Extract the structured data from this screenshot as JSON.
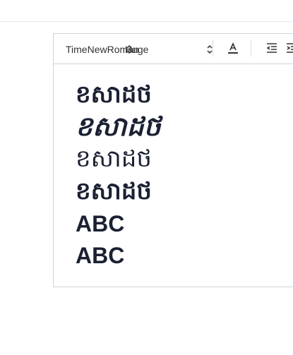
{
  "toolbar": {
    "font_family": "TimeNewRoman",
    "font_size": "Huge"
  },
  "content": {
    "lines": [
      "ខសាដថ",
      "ខសាដថ",
      "ខសាដថ",
      "ខសាដថ",
      "ABC",
      "ABC"
    ]
  },
  "icons": {
    "font_color": "text-color-icon",
    "outdent": "outdent-icon",
    "indent": "indent-icon"
  }
}
